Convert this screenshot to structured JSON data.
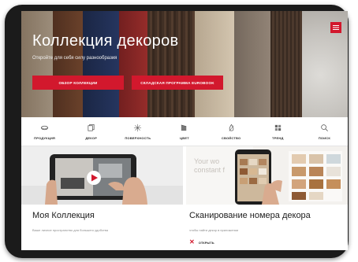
{
  "hero": {
    "title": "Коллекция декоров",
    "subtitle": "Откройте для себя силу разнообразия",
    "button_overview": "ОБЗОР КОЛЛЕКЦИИ",
    "button_stock": "СКЛАДСКАЯ ПРОГРАММА EUROBOOK",
    "menu_icon": "menu-icon"
  },
  "nav": {
    "items": [
      {
        "label": "ПРОДУКЦИЯ",
        "icon": "product-icon"
      },
      {
        "label": "ДЕКОР",
        "icon": "decor-icon"
      },
      {
        "label": "ПОВЕРХНОСТЬ",
        "icon": "surface-icon"
      },
      {
        "label": "ЦВЕТ",
        "icon": "color-icon"
      },
      {
        "label": "СВОЙСТВО",
        "icon": "property-icon"
      },
      {
        "label": "ТРЕНД",
        "icon": "trend-icon"
      },
      {
        "label": "ПОИСК",
        "icon": "search-icon"
      }
    ]
  },
  "cards": {
    "collection": {
      "title": "Моя Коллекция",
      "description": "Ваше личное пространство для большего удобства"
    },
    "scan": {
      "title": "Сканирование номера декора",
      "description": "чтобы найти декор в приложении",
      "open_label": "ОТКРЫТЬ",
      "photo_text_1": "Your wo",
      "photo_text_2": "constant f"
    }
  },
  "colors": {
    "accent": "#d2182d",
    "tablet_frame": "#1b1b1b"
  }
}
